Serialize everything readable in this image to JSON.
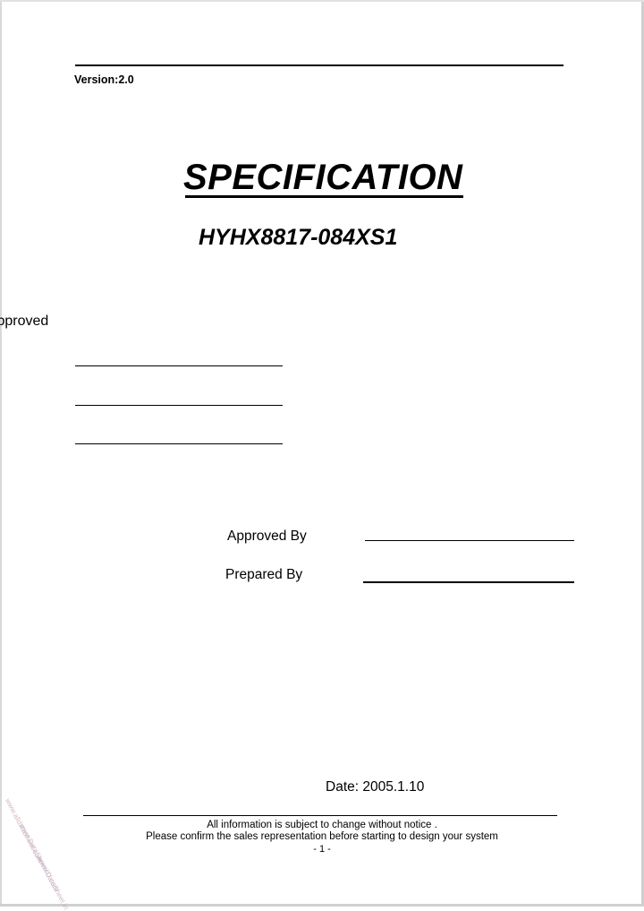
{
  "document": {
    "version_label": "Version:2.0",
    "title": "SPECIFICATION",
    "model_number": "HYHX8817-084XS1",
    "customer_approved_label": "er Approved",
    "approved_by_label": "Approved By",
    "prepared_by_label": "Prepared By",
    "date_label": "Date: 2005.1.10",
    "footer": {
      "line1": "All information is subject to change without notice .",
      "line2": "Please confirm the sales representation before starting to design your system",
      "page_number": "- 1 -"
    },
    "watermarks": {
      "w1": "www.alldatasheet.com",
      "w2": "www.DataSheet4U.com",
      "w3": "www.DataSheet.in"
    }
  }
}
